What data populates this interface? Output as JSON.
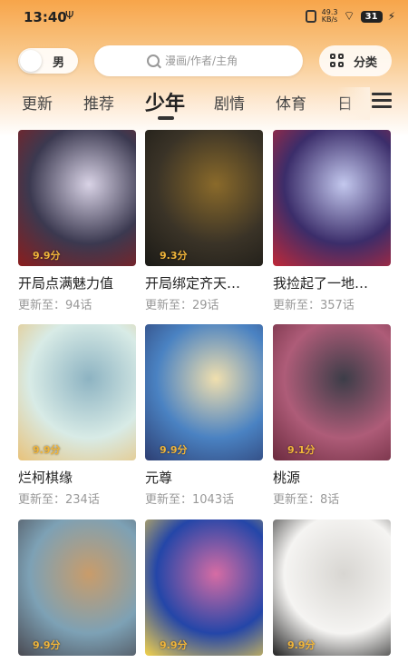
{
  "status": {
    "time": "13:40",
    "usb": "Ψ",
    "speed_top": "49.3",
    "speed_unit": "KB/s",
    "battery": "31"
  },
  "header": {
    "gender_label": "男",
    "search_placeholder": "漫画/作者/主角",
    "category_label": "分类"
  },
  "tabs": [
    {
      "label": "更新"
    },
    {
      "label": "推荐"
    },
    {
      "label": "少年",
      "active": true
    },
    {
      "label": "剧情"
    },
    {
      "label": "体育"
    },
    {
      "label": "日"
    }
  ],
  "comics": [
    {
      "title": "开局点满魅力值",
      "update": "更新至：94话",
      "score": "9.9分",
      "colors": [
        "#3b3950",
        "#d9d3e6",
        "#8b1d1d"
      ]
    },
    {
      "title": "开局绑定齐天…",
      "update": "更新至：29话",
      "score": "9.3分",
      "colors": [
        "#3a3327",
        "#8a6a2a",
        "#1b1a16"
      ]
    },
    {
      "title": "我捡起了一地…",
      "update": "更新至：357话",
      "score": "",
      "colors": [
        "#3b2d6a",
        "#c3c8ee",
        "#c02838"
      ]
    },
    {
      "title": "烂柯棋缘",
      "update": "更新至：234话",
      "score": "9.9分",
      "colors": [
        "#d8ebe6",
        "#8db3c2",
        "#e8c27a"
      ]
    },
    {
      "title": "元尊",
      "update": "更新至：1043话",
      "score": "9.9分",
      "colors": [
        "#4a82c2",
        "#f0dfae",
        "#2d3e72"
      ]
    },
    {
      "title": "桃源",
      "update": "更新至：8话",
      "score": "9.1分",
      "colors": [
        "#ae5c78",
        "#3c3d48",
        "#6b2a3e"
      ]
    },
    {
      "title": "",
      "update": "",
      "score": "9.9分",
      "colors": [
        "#7da1b5",
        "#c99c6a",
        "#4a4a52"
      ]
    },
    {
      "title": "",
      "update": "",
      "score": "9.9分",
      "colors": [
        "#2446a8",
        "#d66ca4",
        "#f3d24a"
      ]
    },
    {
      "title": "",
      "update": "",
      "score": "9.9分",
      "colors": [
        "#f5f4f2",
        "#d8d6d2",
        "#222222"
      ]
    }
  ]
}
